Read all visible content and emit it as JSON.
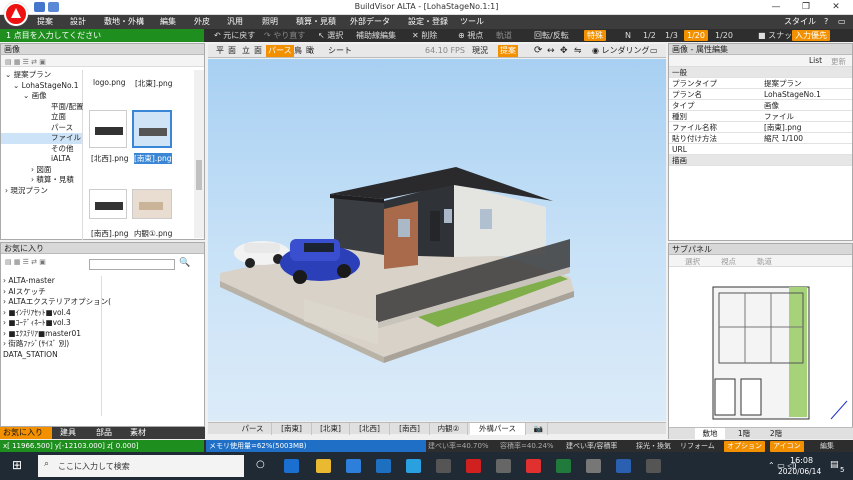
{
  "window": {
    "title": "BuildVisor ALTA - [LohaStageNo.1:1]"
  },
  "menu": [
    "提案",
    "設計",
    "敷地・外構",
    "編集",
    "外皮",
    "汎用",
    "照明",
    "積算・見積",
    "外部データ",
    "設定・登録",
    "ツール"
  ],
  "menu_right": "スタイル",
  "toolbar": {
    "prompt": "1 点目を入力してください",
    "undo": "元に戻す",
    "redo": "やり直す",
    "select": "選択",
    "aux": "補助線編集",
    "delete": "削除",
    "viewpoint": "視点",
    "trajectory": "軌道",
    "rotate": "回転/反転",
    "rotate_val": "特殊",
    "n": "N",
    "scale1": "1/2",
    "scale2": "1/3",
    "scale3": "1/20",
    "scale4": "1/20",
    "snap": "スナップ",
    "input_mode": "入力優先"
  },
  "image_panel": {
    "title": "画像",
    "tree": [
      "提案プラン",
      "LohaStageNo.1",
      "画像",
      "平面/配置",
      "立面",
      "パース",
      "ファイル",
      "その他",
      "iALTA",
      "図面",
      "積算・見積",
      "現況プラン"
    ],
    "thumbs": [
      "logo.png",
      "[北東].png",
      "[北西].png",
      "[南東].png",
      "[南西].png",
      "内観①.png"
    ]
  },
  "fav_panel": {
    "title": "お気に入り",
    "items": [
      "ALTA-master",
      "AIスケッチ",
      "ALTAエクステリアオプション(",
      "■ｲﾝﾃﾘｱｾｯﾄ■vol.4",
      "■ｺｰﾃﾞｨﾈｰﾄ■vol.3",
      "■ｴｸｽﾃﾘｱ■master01",
      "街路ﾌｧｼﾞ(ｻｲｽﾞ 別)",
      "DATA_STATION"
    ],
    "tabs": [
      "お気に入り",
      "建具",
      "部品",
      "素材"
    ]
  },
  "view_toolbar": {
    "modes": [
      "平",
      "面",
      "立",
      "面",
      "パース",
      "鳥",
      "瞰"
    ],
    "sheet": "シート",
    "fps": "64.10 FPS",
    "current": "現況",
    "proposal": "提案",
    "render": "レンダリング"
  },
  "bottom_tabs": [
    "パース",
    "[南東]",
    "[北東]",
    "[北西]",
    "[南西]",
    "内観②",
    "外構パース"
  ],
  "props": {
    "title": "画像 - 属性編集",
    "list": "List",
    "update": "更新",
    "section_general": "一般",
    "rows": [
      [
        "プランタイプ",
        "提案プラン"
      ],
      [
        "プラン名",
        "LohaStageNo.1"
      ],
      [
        "タイプ",
        "画像"
      ],
      [
        "種別",
        "ファイル"
      ],
      [
        "ファイル名称",
        "[南東].png"
      ],
      [
        "貼り付け方法",
        "縮尺 1/100"
      ],
      [
        "URL",
        ""
      ]
    ],
    "section_draw": "描画"
  },
  "subpanel": {
    "title": "サブパネル",
    "buttons": [
      "選択",
      "視点",
      "軌道"
    ],
    "tabs": [
      "敷地",
      "1階",
      "2階"
    ]
  },
  "status": {
    "coords": "x[ 11966.500] y[-12103.000] z[    0.000]",
    "memory": "メモリ使用量=62%(5003MB)",
    "ratio1": "建ぺい率=40.70%",
    "ratio2": "容積率=40.24%",
    "ratio3": "建ぺい率/容積率",
    "lighting": "採光・換気",
    "reform": "リフォーム",
    "btn1": "オプション",
    "btn2": "アイコン",
    "btn3": "編集"
  },
  "taskbar": {
    "search": "ここに入力して検索",
    "time": "16:08",
    "date": "2020/06/14",
    "badge": "5"
  },
  "colors": {
    "accent": "#f39000",
    "green": "#1e8e1e",
    "menubar": "#3c3c3c"
  }
}
